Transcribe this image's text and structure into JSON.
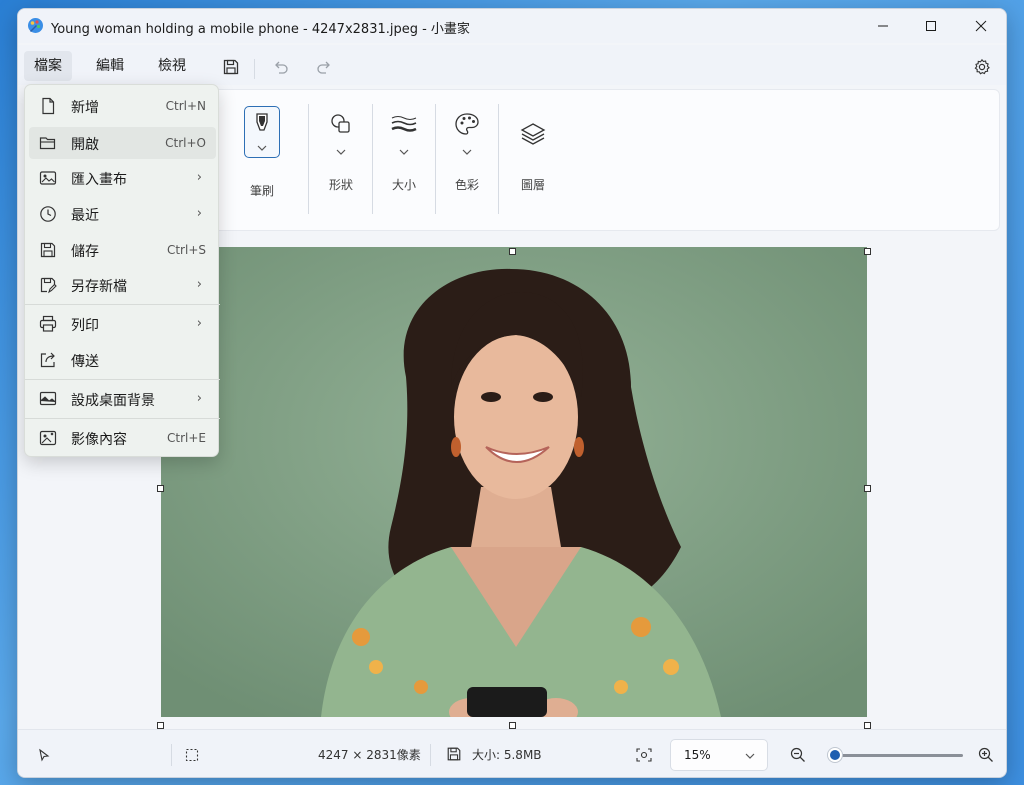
{
  "window": {
    "title": "Young woman holding a mobile phone - 4247x2831.jpeg - 小畫家"
  },
  "menubar": {
    "file": "檔案",
    "edit": "編輯",
    "view": "檢視"
  },
  "ribbon": {
    "brush": "筆刷",
    "shapes": "形狀",
    "size": "大小",
    "color": "色彩",
    "layers": "圖層"
  },
  "file_menu": {
    "new": {
      "label": "新增",
      "shortcut": "Ctrl+N"
    },
    "open": {
      "label": "開啟",
      "shortcut": "Ctrl+O"
    },
    "import_canvas": {
      "label": "匯入畫布"
    },
    "recent": {
      "label": "最近"
    },
    "save": {
      "label": "儲存",
      "shortcut": "Ctrl+S"
    },
    "save_as": {
      "label": "另存新檔"
    },
    "print": {
      "label": "列印"
    },
    "send": {
      "label": "傳送"
    },
    "set_wallpaper": {
      "label": "設成桌面背景"
    },
    "properties": {
      "label": "影像內容",
      "shortcut": "Ctrl+E"
    }
  },
  "statusbar": {
    "dimensions": "4247 × 2831像素",
    "size": "大小: 5.8MB",
    "zoom": "15%",
    "zoom_fraction": 0.05
  },
  "colors": {
    "accent": "#1f5fb0",
    "photo_bg": "#8aa98d"
  }
}
